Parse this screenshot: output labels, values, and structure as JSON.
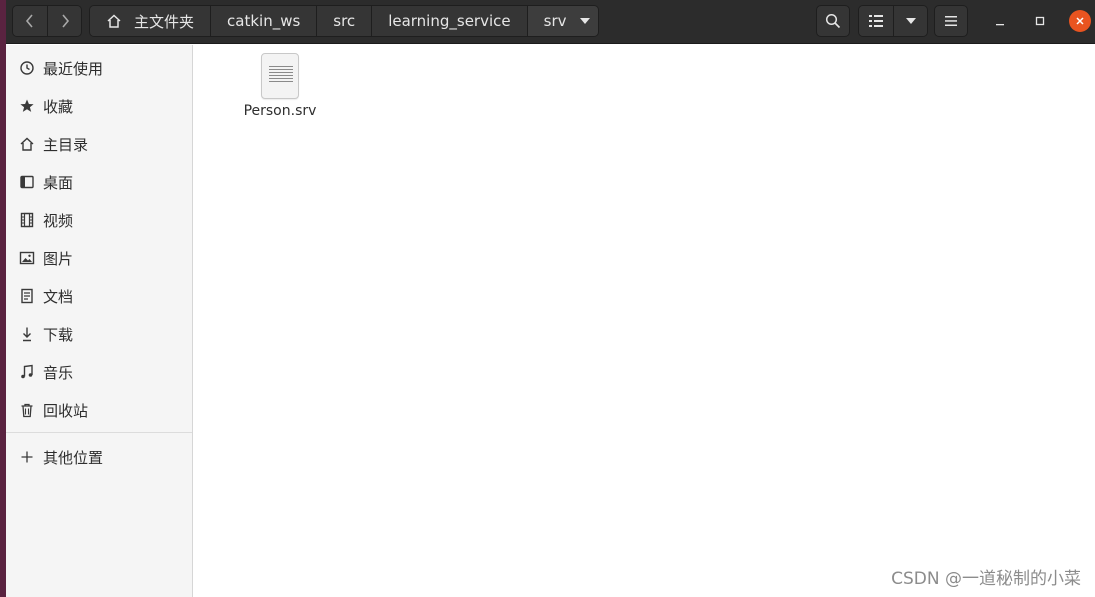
{
  "headerbar": {
    "path": [
      "主文件夹",
      "catkin_ws",
      "src",
      "learning_service",
      "srv"
    ]
  },
  "sidebar": {
    "items": [
      {
        "label": "最近使用",
        "icon": "clock-icon"
      },
      {
        "label": "收藏",
        "icon": "star-icon"
      },
      {
        "label": "主目录",
        "icon": "home-icon"
      },
      {
        "label": "桌面",
        "icon": "desktop-icon"
      },
      {
        "label": "视频",
        "icon": "video-icon"
      },
      {
        "label": "图片",
        "icon": "picture-icon"
      },
      {
        "label": "文档",
        "icon": "document-icon"
      },
      {
        "label": "下载",
        "icon": "download-icon"
      },
      {
        "label": "音乐",
        "icon": "music-icon"
      },
      {
        "label": "回收站",
        "icon": "trash-icon"
      }
    ],
    "other_locations": {
      "label": "其他位置",
      "icon": "plus-icon"
    }
  },
  "files": [
    {
      "name": "Person.srv",
      "icon": "text-file-icon"
    }
  ],
  "watermark": "CSDN @一道秘制的小菜",
  "colors": {
    "headerbar": "#2c2c2c",
    "close_button": "#e95420",
    "sidebar": "#f5f5f5"
  }
}
